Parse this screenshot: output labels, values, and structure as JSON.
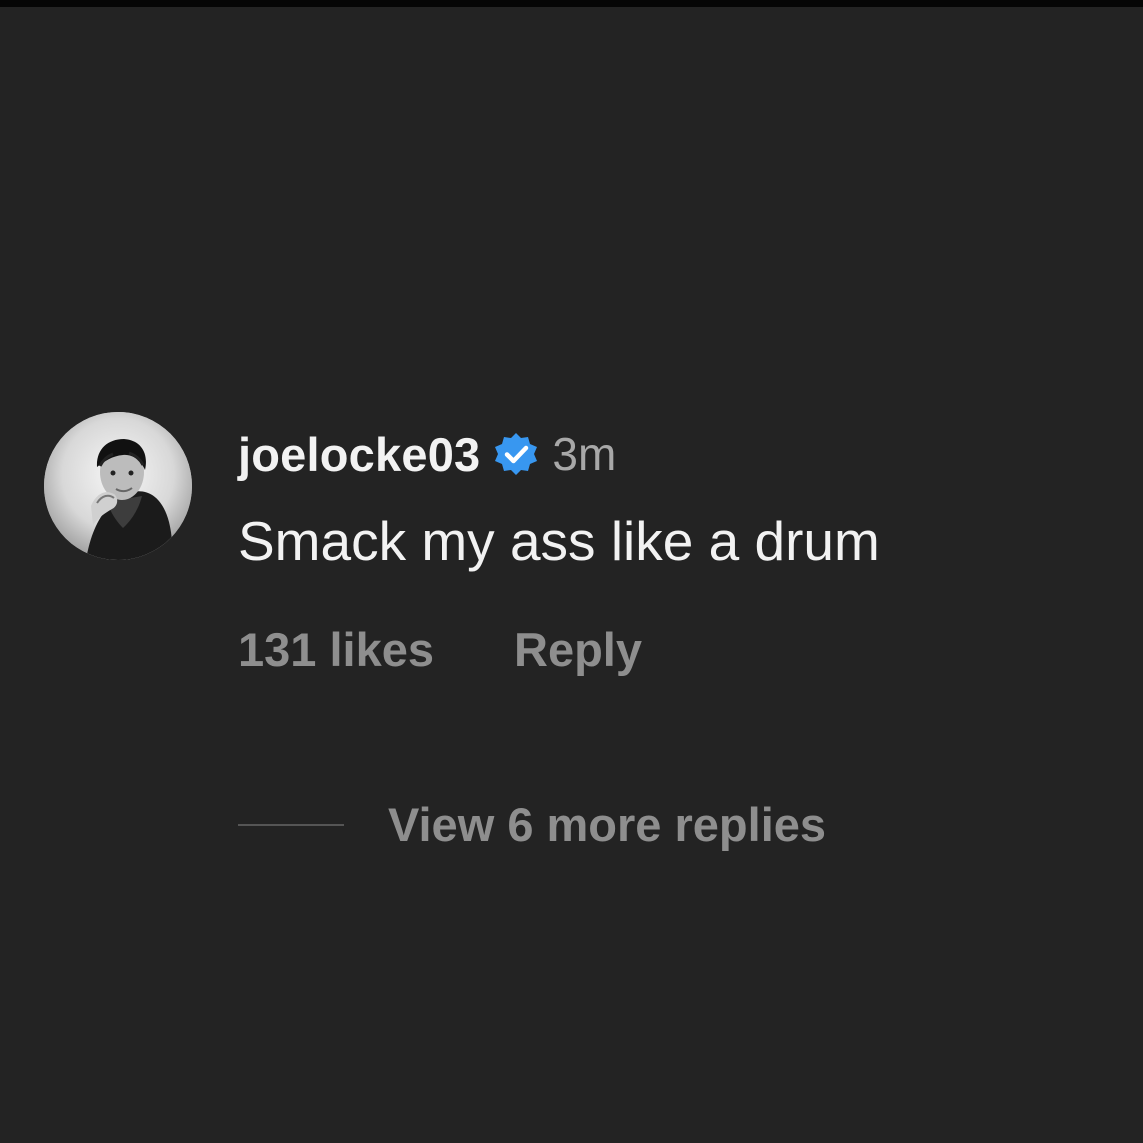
{
  "comment": {
    "username": "joelocke03",
    "verified": true,
    "verified_icon": "verified-badge-icon",
    "verified_color": "#3897f0",
    "timestamp": "3m",
    "text": "Smack my ass like a drum",
    "avatar_icon": "profile-photo",
    "likes_label": "131 likes",
    "reply_label": "Reply",
    "view_replies_label": "View 6 more replies"
  },
  "colors": {
    "background": "#232323",
    "primary_text": "#f2f2f2",
    "secondary_text": "#8e8e8e",
    "timestamp_text": "#a8a8a8",
    "divider": "#555555"
  }
}
